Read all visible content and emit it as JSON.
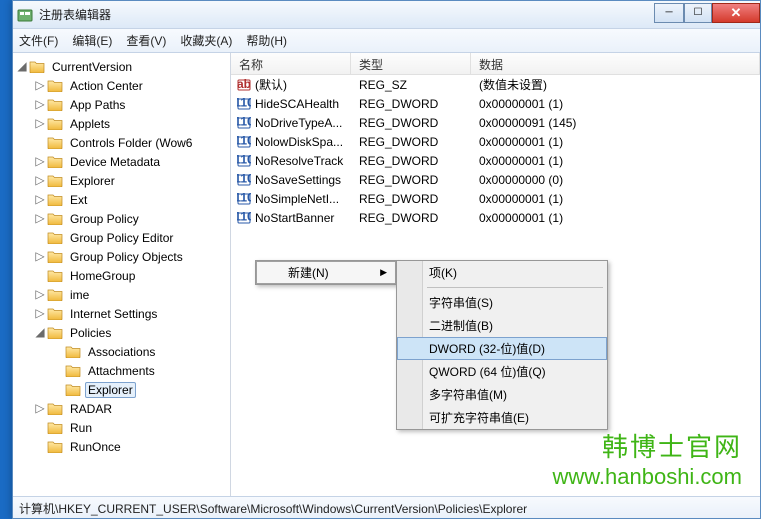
{
  "window": {
    "title": "注册表编辑器"
  },
  "menubar": [
    "文件(F)",
    "编辑(E)",
    "查看(V)",
    "收藏夹(A)",
    "帮助(H)"
  ],
  "tree": {
    "root": "CurrentVersion",
    "items": [
      {
        "label": "Action Center",
        "exp": true
      },
      {
        "label": "App Paths",
        "exp": true
      },
      {
        "label": "Applets",
        "exp": true
      },
      {
        "label": "Controls Folder (Wow6",
        "exp": false
      },
      {
        "label": "Device Metadata",
        "exp": true
      },
      {
        "label": "Explorer",
        "exp": true
      },
      {
        "label": "Ext",
        "exp": true
      },
      {
        "label": "Group Policy",
        "exp": true
      },
      {
        "label": "Group Policy Editor",
        "exp": false
      },
      {
        "label": "Group Policy Objects",
        "exp": true
      },
      {
        "label": "HomeGroup",
        "exp": false
      },
      {
        "label": "ime",
        "exp": true
      },
      {
        "label": "Internet Settings",
        "exp": true
      },
      {
        "label": "Policies",
        "exp": true,
        "open": true,
        "children": [
          {
            "label": "Associations"
          },
          {
            "label": "Attachments"
          },
          {
            "label": "Explorer",
            "selected": true
          }
        ]
      },
      {
        "label": "RADAR",
        "exp": true
      },
      {
        "label": "Run",
        "exp": false
      },
      {
        "label": "RunOnce",
        "exp": false
      }
    ]
  },
  "grid": {
    "headers": {
      "name": "名称",
      "type": "类型",
      "data": "数据"
    },
    "rows": [
      {
        "icon": "sz",
        "name": "(默认)",
        "type": "REG_SZ",
        "data": "(数值未设置)"
      },
      {
        "icon": "dw",
        "name": "HideSCAHealth",
        "type": "REG_DWORD",
        "data": "0x00000001 (1)"
      },
      {
        "icon": "dw",
        "name": "NoDriveTypeA...",
        "type": "REG_DWORD",
        "data": "0x00000091 (145)"
      },
      {
        "icon": "dw",
        "name": "NolowDiskSpa...",
        "type": "REG_DWORD",
        "data": "0x00000001 (1)"
      },
      {
        "icon": "dw",
        "name": "NoResolveTrack",
        "type": "REG_DWORD",
        "data": "0x00000001 (1)"
      },
      {
        "icon": "dw",
        "name": "NoSaveSettings",
        "type": "REG_DWORD",
        "data": "0x00000000 (0)"
      },
      {
        "icon": "dw",
        "name": "NoSimpleNetI...",
        "type": "REG_DWORD",
        "data": "0x00000001 (1)"
      },
      {
        "icon": "dw",
        "name": "NoStartBanner",
        "type": "REG_DWORD",
        "data": "0x00000001 (1)"
      }
    ]
  },
  "context": {
    "main": {
      "label": "新建(N)"
    },
    "sub": [
      {
        "label": "项(K)"
      },
      {
        "sep": true
      },
      {
        "label": "字符串值(S)"
      },
      {
        "label": "二进制值(B)"
      },
      {
        "label": "DWORD (32-位)值(D)",
        "hi": true
      },
      {
        "label": "QWORD (64 位)值(Q)"
      },
      {
        "label": "多字符串值(M)"
      },
      {
        "label": "可扩充字符串值(E)"
      }
    ]
  },
  "statusbar": "计算机\\HKEY_CURRENT_USER\\Software\\Microsoft\\Windows\\CurrentVersion\\Policies\\Explorer",
  "watermark": {
    "l1": "韩博士官网",
    "l2": "www.hanboshi.com"
  }
}
